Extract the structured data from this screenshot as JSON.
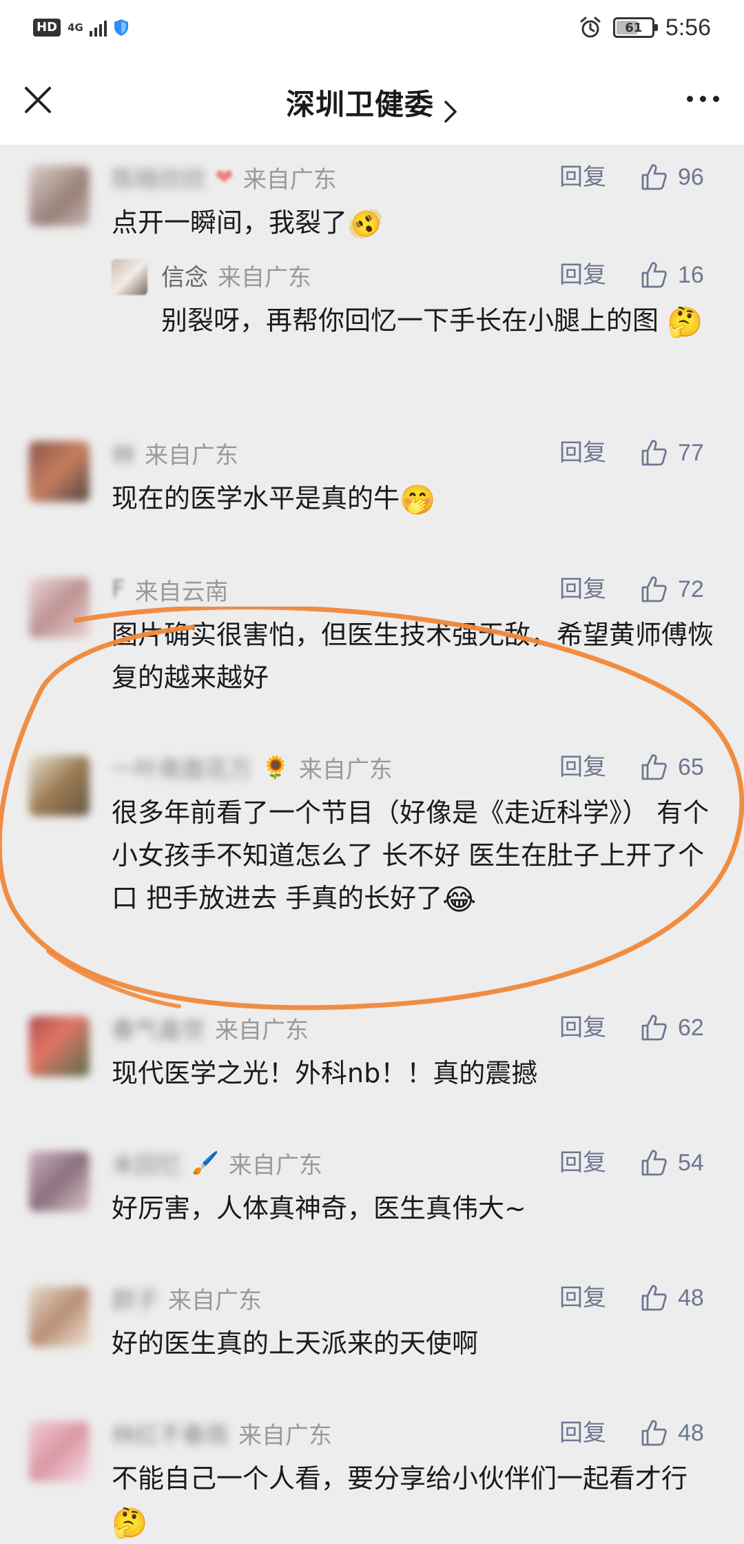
{
  "status_bar": {
    "hd": "HD",
    "network": "4G",
    "battery": "61",
    "time": "5:56"
  },
  "header": {
    "title": "深圳卫健委",
    "chevron": ">"
  },
  "labels": {
    "reply": "回复"
  },
  "comments": [
    {
      "name": "陈晓欣欣",
      "name_icon": "❤",
      "location": "来自广东",
      "likes": "96",
      "text": "点开一瞬间，我裂了",
      "emoji": "🫨"
    },
    {
      "name": "信念",
      "location": "来自广东",
      "likes": "16",
      "text": "别裂呀，再帮你回忆一下手长在小腿上的图",
      "emoji": "🤔",
      "is_reply": true
    },
    {
      "name": "林",
      "location": "来自广东",
      "likes": "77",
      "text": "现在的医学水平是真的牛",
      "emoji": "🤭"
    },
    {
      "name": "F",
      "location": "来自云南",
      "likes": "72",
      "text": "图片确实很害怕，但医生技术强无敌，希望黄师傅恢复的越来越好"
    },
    {
      "name": "一叶南面花万",
      "name_icon": "🌻",
      "location": "来自广东",
      "likes": "65",
      "text": "很多年前看了一个节目（好像是《走近科学》） 有个小女孩手不知道怎么了 长不好 医生在肚子上开了个口 把手放进去 手真的长好了",
      "emoji": "😂"
    },
    {
      "name": "春气盎世",
      "location": "来自广东",
      "likes": "62",
      "text": "现代医学之光！外科nb！！真的震撼"
    },
    {
      "name": "未回忆",
      "name_icon": "🖌️",
      "location": "来自广东",
      "likes": "54",
      "text": "好厉害，人体真神奇，医生真伟大~"
    },
    {
      "name": "颜子",
      "location": "来自广东",
      "likes": "48",
      "text": "好的医生真的上天派来的天使啊"
    },
    {
      "name": "林红不春雨",
      "location": "来自广东",
      "likes": "48",
      "text": "不能自己一个人看，要分享给小伙伴们一起看才行",
      "emoji": "🤔"
    }
  ],
  "colors": {
    "background": "#ededed",
    "header_bg": "#ffffff",
    "link": "#6d7790",
    "annotation_circle": "#f0883a"
  }
}
